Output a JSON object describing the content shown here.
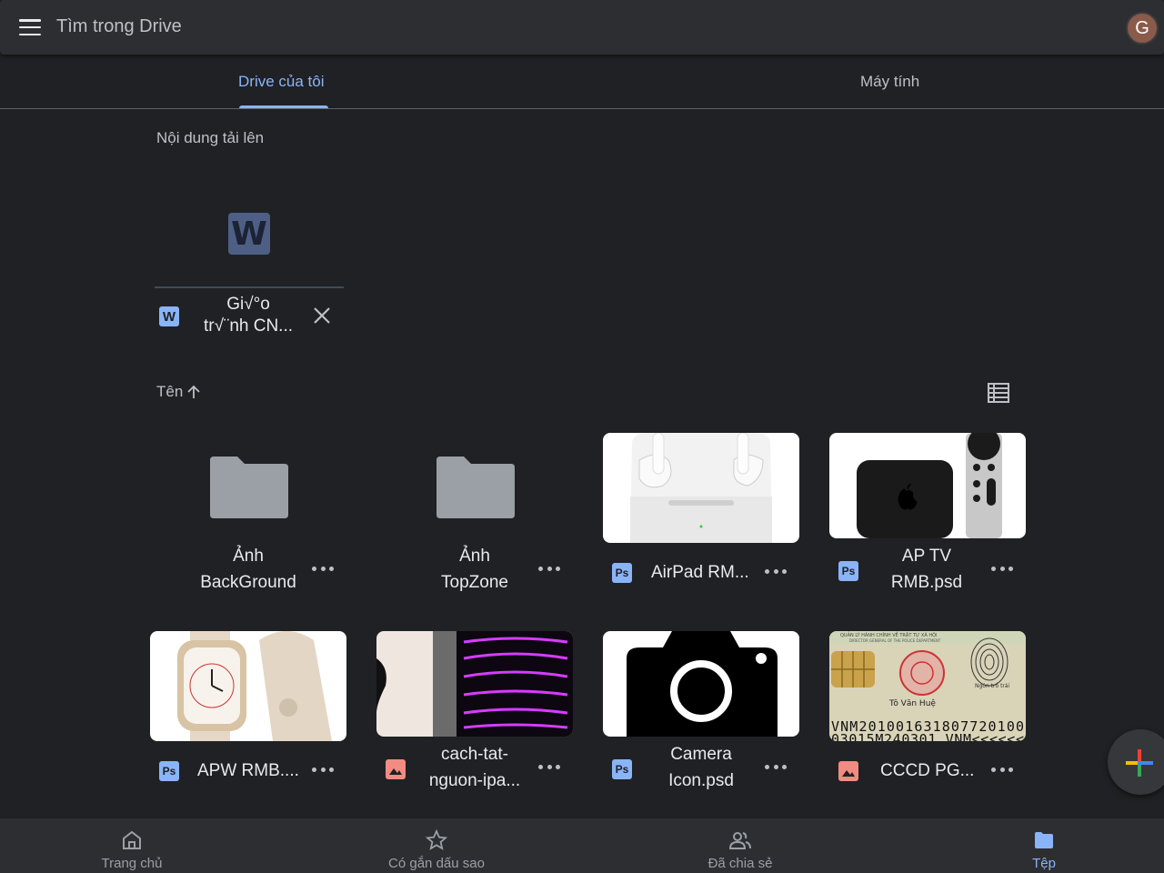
{
  "search": {
    "placeholder": "Tìm trong Drive"
  },
  "avatar": {
    "initial": "G",
    "color": "#8a5a4a"
  },
  "tabs": [
    {
      "label": "Drive của tôi",
      "active": true
    },
    {
      "label": "Máy tính",
      "active": false
    }
  ],
  "uploads": {
    "title": "Nội dung tải lên",
    "file": {
      "name_line1": "Gi√°o",
      "name_line2": "tr√¨nh CN...",
      "icon": "word-icon"
    }
  },
  "sort": {
    "label": "Tên",
    "direction_icon": "arrow-up-icon"
  },
  "items": [
    {
      "name_line1": "Ảnh",
      "name_line2": "BackGround",
      "type": "folder"
    },
    {
      "name_line1": "Ảnh",
      "name_line2": "TopZone",
      "type": "folder"
    },
    {
      "name": "AirPad RM...",
      "type": "psd",
      "type_label": "Ps"
    },
    {
      "name_line1": "AP TV",
      "name_line2": "RMB.psd",
      "type": "psd",
      "type_label": "Ps"
    },
    {
      "name": "APW RMB....",
      "type": "psd",
      "type_label": "Ps"
    },
    {
      "name_line1": "cach-tat-",
      "name_line2": "nguon-ipa...",
      "type": "image"
    },
    {
      "name_line1": "Camera",
      "name_line2": "Icon.psd",
      "type": "psd",
      "type_label": "Ps"
    },
    {
      "name": "CCCD PG...",
      "type": "image"
    }
  ],
  "cccd_thumb": {
    "header": "QUẢN LÝ HÀNH CHÍNH VỀ TRẬT TỰ XÃ HỘI",
    "subheader": "DIRECTOR GENERAL OF THE POLICE DEPARTMENT",
    "signer": "Tô Văn Huệ",
    "finger": "Ngón trỏ trái",
    "mrz1": "VNM201001631807720100",
    "mrz2": "03015M240301 VNM<<<<<<"
  },
  "nav": [
    {
      "label": "Trang chủ",
      "icon": "home-icon",
      "active": false
    },
    {
      "label": "Có gắn dấu sao",
      "icon": "star-icon",
      "active": false
    },
    {
      "label": "Đã chia sẻ",
      "icon": "people-icon",
      "active": false
    },
    {
      "label": "Tệp",
      "icon": "folder-icon",
      "active": true
    }
  ],
  "colors": {
    "accent": "#8ab4f8",
    "background": "#202124",
    "surface": "#2d2e31"
  }
}
